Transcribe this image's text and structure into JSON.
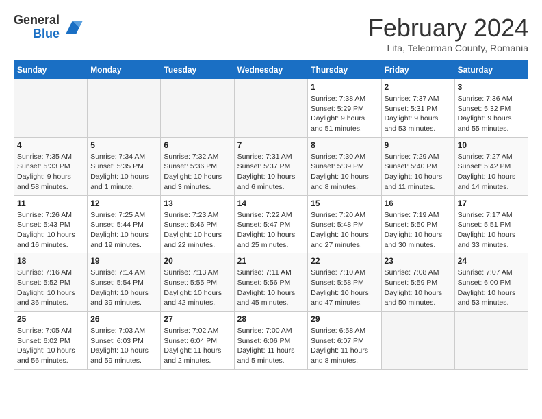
{
  "header": {
    "logo_general": "General",
    "logo_blue": "Blue",
    "month_title": "February 2024",
    "location": "Lita, Teleorman County, Romania"
  },
  "weekdays": [
    "Sunday",
    "Monday",
    "Tuesday",
    "Wednesday",
    "Thursday",
    "Friday",
    "Saturday"
  ],
  "weeks": [
    [
      {
        "day": "",
        "info": ""
      },
      {
        "day": "",
        "info": ""
      },
      {
        "day": "",
        "info": ""
      },
      {
        "day": "",
        "info": ""
      },
      {
        "day": "1",
        "info": "Sunrise: 7:38 AM\nSunset: 5:29 PM\nDaylight: 9 hours\nand 51 minutes."
      },
      {
        "day": "2",
        "info": "Sunrise: 7:37 AM\nSunset: 5:31 PM\nDaylight: 9 hours\nand 53 minutes."
      },
      {
        "day": "3",
        "info": "Sunrise: 7:36 AM\nSunset: 5:32 PM\nDaylight: 9 hours\nand 55 minutes."
      }
    ],
    [
      {
        "day": "4",
        "info": "Sunrise: 7:35 AM\nSunset: 5:33 PM\nDaylight: 9 hours\nand 58 minutes."
      },
      {
        "day": "5",
        "info": "Sunrise: 7:34 AM\nSunset: 5:35 PM\nDaylight: 10 hours\nand 1 minute."
      },
      {
        "day": "6",
        "info": "Sunrise: 7:32 AM\nSunset: 5:36 PM\nDaylight: 10 hours\nand 3 minutes."
      },
      {
        "day": "7",
        "info": "Sunrise: 7:31 AM\nSunset: 5:37 PM\nDaylight: 10 hours\nand 6 minutes."
      },
      {
        "day": "8",
        "info": "Sunrise: 7:30 AM\nSunset: 5:39 PM\nDaylight: 10 hours\nand 8 minutes."
      },
      {
        "day": "9",
        "info": "Sunrise: 7:29 AM\nSunset: 5:40 PM\nDaylight: 10 hours\nand 11 minutes."
      },
      {
        "day": "10",
        "info": "Sunrise: 7:27 AM\nSunset: 5:42 PM\nDaylight: 10 hours\nand 14 minutes."
      }
    ],
    [
      {
        "day": "11",
        "info": "Sunrise: 7:26 AM\nSunset: 5:43 PM\nDaylight: 10 hours\nand 16 minutes."
      },
      {
        "day": "12",
        "info": "Sunrise: 7:25 AM\nSunset: 5:44 PM\nDaylight: 10 hours\nand 19 minutes."
      },
      {
        "day": "13",
        "info": "Sunrise: 7:23 AM\nSunset: 5:46 PM\nDaylight: 10 hours\nand 22 minutes."
      },
      {
        "day": "14",
        "info": "Sunrise: 7:22 AM\nSunset: 5:47 PM\nDaylight: 10 hours\nand 25 minutes."
      },
      {
        "day": "15",
        "info": "Sunrise: 7:20 AM\nSunset: 5:48 PM\nDaylight: 10 hours\nand 27 minutes."
      },
      {
        "day": "16",
        "info": "Sunrise: 7:19 AM\nSunset: 5:50 PM\nDaylight: 10 hours\nand 30 minutes."
      },
      {
        "day": "17",
        "info": "Sunrise: 7:17 AM\nSunset: 5:51 PM\nDaylight: 10 hours\nand 33 minutes."
      }
    ],
    [
      {
        "day": "18",
        "info": "Sunrise: 7:16 AM\nSunset: 5:52 PM\nDaylight: 10 hours\nand 36 minutes."
      },
      {
        "day": "19",
        "info": "Sunrise: 7:14 AM\nSunset: 5:54 PM\nDaylight: 10 hours\nand 39 minutes."
      },
      {
        "day": "20",
        "info": "Sunrise: 7:13 AM\nSunset: 5:55 PM\nDaylight: 10 hours\nand 42 minutes."
      },
      {
        "day": "21",
        "info": "Sunrise: 7:11 AM\nSunset: 5:56 PM\nDaylight: 10 hours\nand 45 minutes."
      },
      {
        "day": "22",
        "info": "Sunrise: 7:10 AM\nSunset: 5:58 PM\nDaylight: 10 hours\nand 47 minutes."
      },
      {
        "day": "23",
        "info": "Sunrise: 7:08 AM\nSunset: 5:59 PM\nDaylight: 10 hours\nand 50 minutes."
      },
      {
        "day": "24",
        "info": "Sunrise: 7:07 AM\nSunset: 6:00 PM\nDaylight: 10 hours\nand 53 minutes."
      }
    ],
    [
      {
        "day": "25",
        "info": "Sunrise: 7:05 AM\nSunset: 6:02 PM\nDaylight: 10 hours\nand 56 minutes."
      },
      {
        "day": "26",
        "info": "Sunrise: 7:03 AM\nSunset: 6:03 PM\nDaylight: 10 hours\nand 59 minutes."
      },
      {
        "day": "27",
        "info": "Sunrise: 7:02 AM\nSunset: 6:04 PM\nDaylight: 11 hours\nand 2 minutes."
      },
      {
        "day": "28",
        "info": "Sunrise: 7:00 AM\nSunset: 6:06 PM\nDaylight: 11 hours\nand 5 minutes."
      },
      {
        "day": "29",
        "info": "Sunrise: 6:58 AM\nSunset: 6:07 PM\nDaylight: 11 hours\nand 8 minutes."
      },
      {
        "day": "",
        "info": ""
      },
      {
        "day": "",
        "info": ""
      }
    ]
  ]
}
